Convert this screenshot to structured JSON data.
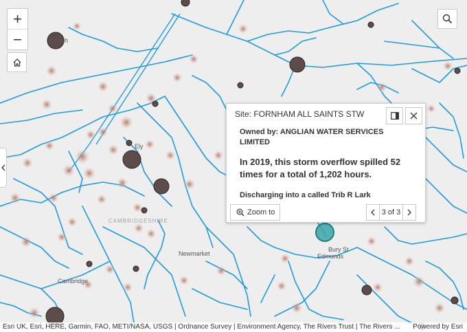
{
  "map": {
    "places": [
      {
        "id": "march",
        "text": "March"
      },
      {
        "id": "ely",
        "text": "Ely"
      },
      {
        "id": "cambridgeshire",
        "text": "CAMBRIDGESHIRE"
      },
      {
        "id": "newmarket",
        "text": "Newmarket"
      },
      {
        "id": "cambridge",
        "text": "Cambridge"
      },
      {
        "id": "bury1",
        "text": "Bury St"
      },
      {
        "id": "bury2",
        "text": "Edmunds"
      }
    ],
    "colors": {
      "river": "#1e9be0",
      "road": "#1e9be0",
      "marker_fill": "#5c4d4a",
      "marker_stroke": "#2c2220",
      "glow": "#b06a55",
      "selected": "#3aa6a6",
      "background": "#eeeeee"
    }
  },
  "controls": {
    "zoom_in_icon": "plus-icon",
    "zoom_out_icon": "minus-icon",
    "home_icon": "home-icon",
    "search_icon": "search-icon",
    "collapse_icon": "chevron-left-icon",
    "zoom_in": "+",
    "zoom_out": "−"
  },
  "popup": {
    "title": "Site: FORNHAM ALL SAINTS STW",
    "owned": "Owned by: ANGLIAN WATER SERVICES LIMITED",
    "spill": "In 2019, this storm overflow spilled 52 times for a total of 1,202 hours.",
    "discharge": "Discharging into a called Trib R Lark",
    "zoom_to": "Zoom to",
    "page_count": "3 of 3"
  },
  "attribution": {
    "text": "Esri UK, Esri, HERE, Garmin, FAO, METI/NASA, USGS | Ordnance Survey | Environment Agency, The Rivers Trust | The Rivers ...",
    "powered": "Powered by Esri"
  }
}
